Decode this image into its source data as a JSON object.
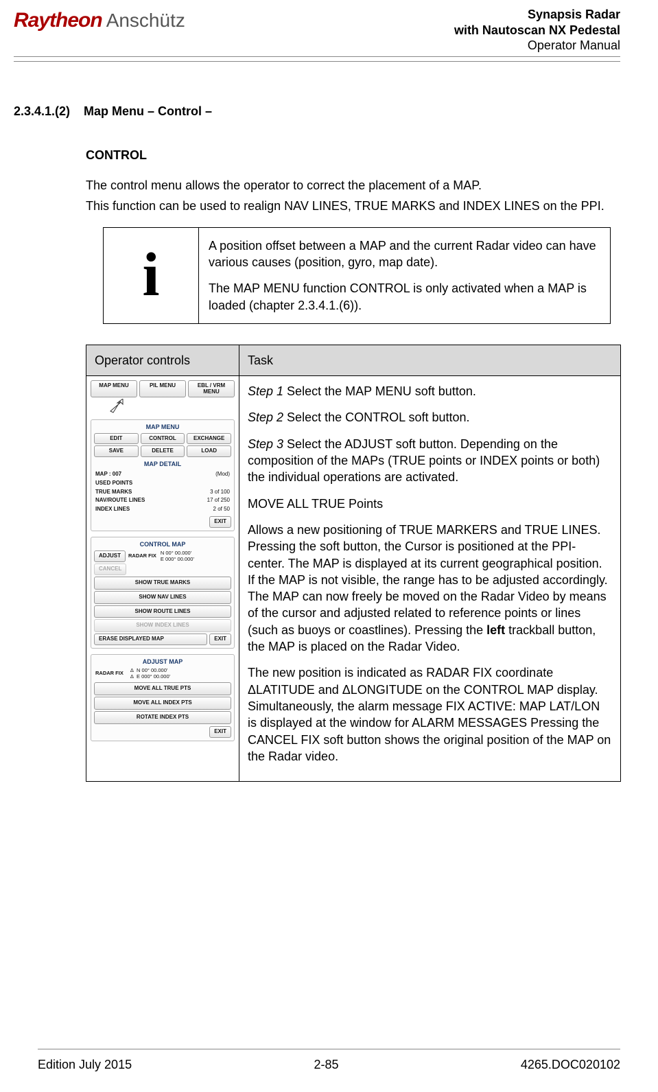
{
  "header": {
    "logo_primary": "Raytheon",
    "logo_secondary": "Anschütz",
    "title_line1": "Synapsis Radar",
    "title_line2": "with Nautoscan NX Pedestal",
    "title_line3": "Operator Manual"
  },
  "section": {
    "number": "2.3.4.1.(2)",
    "title": "Map Menu – Control –"
  },
  "subheading": "CONTROL",
  "intro": {
    "p1": "The control menu allows the operator to correct the placement of a MAP.",
    "p2": "This function can be used to realign NAV LINES, TRUE MARKS and INDEX LINES on the PPI."
  },
  "info": {
    "p1": "A position offset between a MAP and the current Radar video can have various causes (position, gyro, map date).",
    "p2": "The MAP MENU function CONTROL is only activated when a MAP is loaded (chapter 2.3.4.1.(6))."
  },
  "table": {
    "col1": "Operator controls",
    "col2": "Task"
  },
  "mock": {
    "top_buttons": [
      "MAP MENU",
      "PIL MENU",
      "EBL / VRM MENU"
    ],
    "map_menu": {
      "title": "MAP MENU",
      "row1": [
        "EDIT",
        "CONTROL",
        "EXCHANGE"
      ],
      "row2": [
        "SAVE",
        "DELETE",
        "LOAD"
      ],
      "detail_title": "MAP DETAIL",
      "map_line_key": "MAP : 007",
      "map_line_val": "(Mod)",
      "used_points": "USED POINTS",
      "rows": [
        {
          "k": "TRUE MARKS",
          "v": "3  of   100"
        },
        {
          "k": "NAV/ROUTE LINES",
          "v": "17  of   250"
        },
        {
          "k": "INDEX LINES",
          "v": "2  of    50"
        }
      ],
      "exit": "EXIT"
    },
    "control_map": {
      "title": "CONTROL MAP",
      "adjust": "ADJUST",
      "cancel": "CANCEL",
      "radar_fix_label": "RADAR FIX",
      "lat": "N 00° 00.000'",
      "lon": "E 000° 00.000'",
      "buttons": [
        "SHOW TRUE MARKS",
        "SHOW NAV LINES",
        "SHOW ROUTE LINES"
      ],
      "disabled": "SHOW INDEX LINES",
      "erase": "ERASE DISPLAYED MAP",
      "exit": "EXIT"
    },
    "adjust_map": {
      "title": "ADJUST MAP",
      "radar_fix_label": "RADAR FIX",
      "lat": "N 00° 00.000'",
      "lon": "E 000° 00.000'",
      "buttons": [
        "MOVE ALL TRUE PTS",
        "MOVE ALL INDEX PTS",
        "ROTATE INDEX PTS"
      ],
      "exit": "EXIT"
    }
  },
  "task": {
    "s1_label": "Step 1",
    "s1_text": " Select the MAP MENU soft button.",
    "s2_label": "Step 2",
    "s2_text": " Select the CONTROL soft button.",
    "s3_label": "Step 3",
    "s3_text": " Select the ADJUST soft button. Depending on the composition of the MAPs (TRUE points or INDEX points or both) the individual operations are activated.",
    "h_move": "MOVE ALL TRUE Points",
    "p_move1_a": "Allows a new positioning of TRUE MARKERS and TRUE LINES. Pressing the soft button, the Cursor is positioned at the PPI- center. The MAP is displayed at its current geographical position. If the MAP is not visible, the range has to be adjusted accordingly. The MAP can now freely be moved on the Radar Video by means of the cursor and adjusted related to reference points or lines (such as buoys or coastlines). Pressing the ",
    "p_move1_bold": "left",
    "p_move1_b": " trackball button, the MAP is placed on the Radar Video.",
    "p_move2": "The new position is indicated as RADAR FIX coordinate ΔLATITUDE and ΔLONGITUDE on the CONTROL MAP display. Simultaneously, the alarm message FIX ACTIVE: MAP LAT/LON is displayed at the window for ALARM MESSAGES Pressing the CANCEL FIX soft button shows the original position of the MAP on the Radar video."
  },
  "footer": {
    "left": "Edition July 2015",
    "center": "2-85",
    "right": "4265.DOC020102"
  }
}
